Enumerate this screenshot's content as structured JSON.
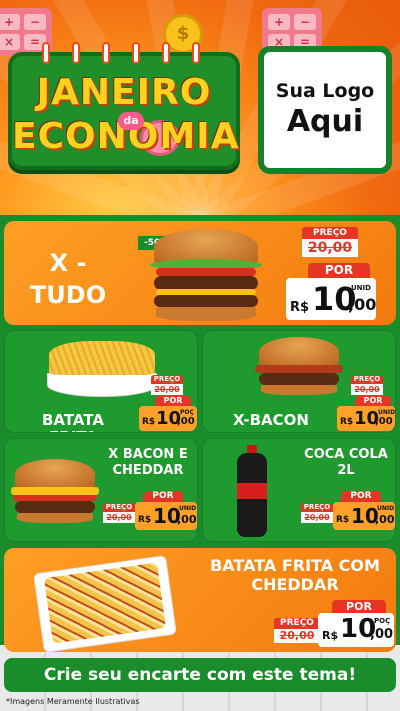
{
  "hero": {
    "title_line1": "JANEIRO",
    "title_connector": "da",
    "title_line2": "ECONOMIA",
    "calc_keys": [
      "+",
      "−",
      "×",
      "="
    ],
    "coin_symbol": "$",
    "logo_line1": "Sua Logo",
    "logo_line2": "Aqui"
  },
  "colors": {
    "green": "#1b8c2b",
    "orange": "#f37a0e",
    "red": "#e53624",
    "yellow": "#ffd21f"
  },
  "products": [
    {
      "name": "X - TUDO",
      "badge": "-50%",
      "price_label": "PREÇO",
      "old_price": "20,00",
      "por_label": "POR",
      "currency": "R$",
      "price_int": "10",
      "price_dec": ",00",
      "unit": "UNID"
    },
    {
      "name": "BATATA FRITA",
      "price_label": "PREÇO",
      "old_price": "20,00",
      "por_label": "POR",
      "currency": "R$",
      "price_int": "10",
      "price_dec": ",00",
      "unit": "POÇ"
    },
    {
      "name": "X-BACON",
      "price_label": "PREÇO",
      "old_price": "20,00",
      "por_label": "POR",
      "currency": "R$",
      "price_int": "10",
      "price_dec": ",00",
      "unit": "UNID"
    },
    {
      "name": "X BACON E CHEDDAR",
      "price_label": "PREÇO",
      "old_price": "20,00",
      "por_label": "POR",
      "currency": "R$",
      "price_int": "10",
      "price_dec": ",00",
      "unit": "UNID"
    },
    {
      "name": "COCA COLA 2L",
      "price_label": "PREÇO",
      "old_price": "20,00",
      "por_label": "POR",
      "currency": "R$",
      "price_int": "10",
      "price_dec": ",00",
      "unit": "UNID"
    },
    {
      "name": "BATATA FRITA COM CHEDDAR",
      "price_label": "PREÇO",
      "old_price": "20,00",
      "por_label": "POR",
      "currency": "R$",
      "price_int": "10",
      "price_dec": ",00",
      "unit": "POÇ"
    }
  ],
  "cta": "Crie seu encarte com este tema!",
  "footnote": "*Imagens Meramente Ilustrativas"
}
